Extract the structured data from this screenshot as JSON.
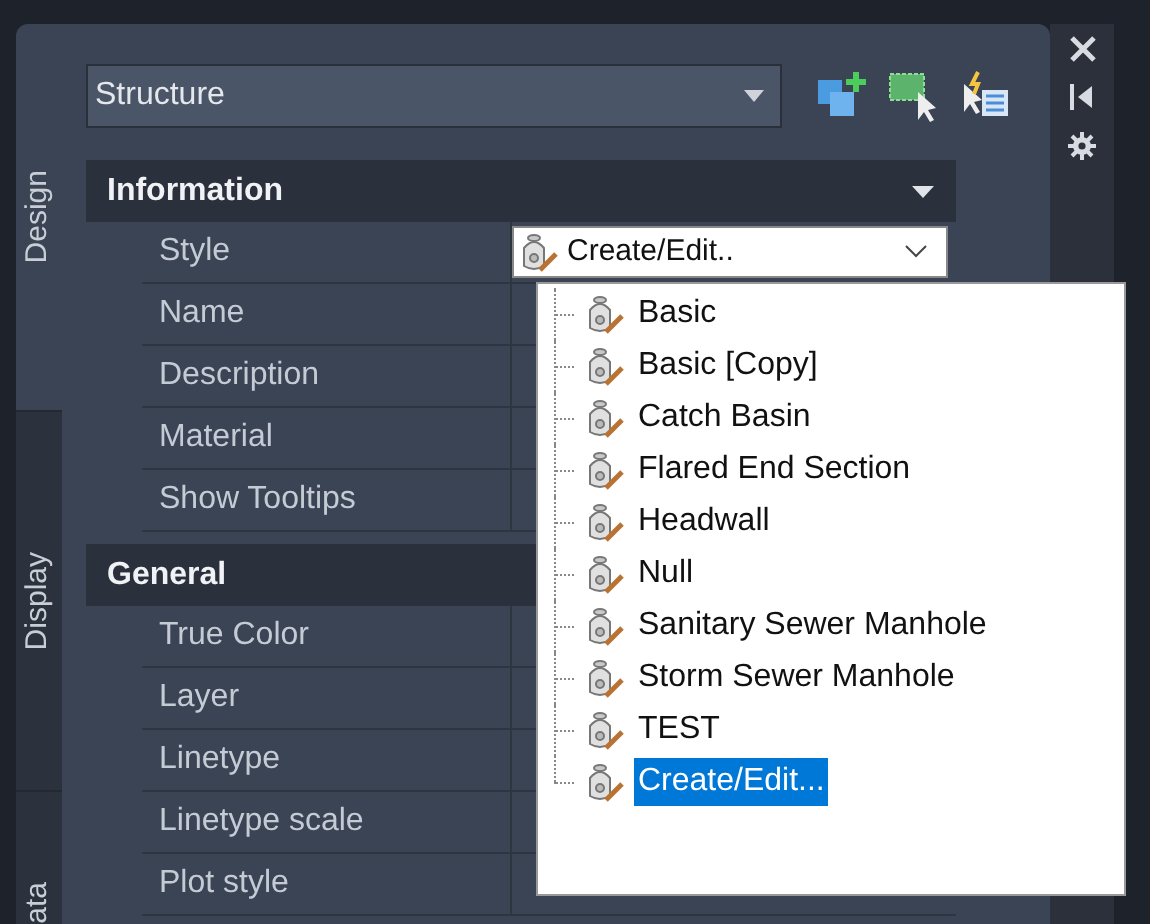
{
  "side_tabs": [
    {
      "label": "Design",
      "selected": true
    },
    {
      "label": "Display",
      "selected": false
    },
    {
      "label": "ata",
      "selected": false
    }
  ],
  "object_type": {
    "value": "Structure"
  },
  "sections": [
    {
      "title": "Information",
      "expanded": true,
      "rows": [
        {
          "label": "Style",
          "value": "Create/Edit.."
        },
        {
          "label": "Name"
        },
        {
          "label": "Description"
        },
        {
          "label": "Material"
        },
        {
          "label": "Show Tooltips"
        }
      ]
    },
    {
      "title": "General",
      "expanded": true,
      "rows": [
        {
          "label": "True Color"
        },
        {
          "label": "Layer"
        },
        {
          "label": "Linetype"
        },
        {
          "label": "Linetype scale"
        },
        {
          "label": "Plot style"
        }
      ]
    }
  ],
  "style_list": [
    {
      "label": "Basic",
      "selected": false
    },
    {
      "label": "Basic [Copy]",
      "selected": false
    },
    {
      "label": "Catch Basin",
      "selected": false
    },
    {
      "label": "Flared End Section",
      "selected": false
    },
    {
      "label": "Headwall",
      "selected": false
    },
    {
      "label": "Null",
      "selected": false
    },
    {
      "label": "Sanitary Sewer Manhole",
      "selected": false
    },
    {
      "label": "Storm Sewer Manhole",
      "selected": false
    },
    {
      "label": "TEST",
      "selected": false
    },
    {
      "label": "Create/Edit...",
      "selected": true
    }
  ]
}
